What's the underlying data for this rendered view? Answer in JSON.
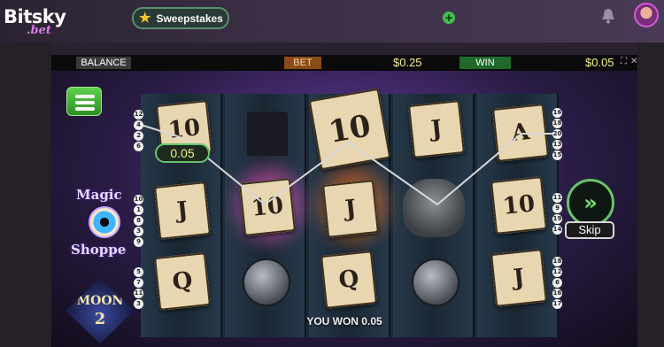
{
  "header": {
    "logo_text": "Bitsky",
    "logo_sub": ".bet",
    "sweepstakes_label": "Sweepstakes",
    "add_label": "+"
  },
  "hud": {
    "balance_label": "BALANCE",
    "bet_label": "BET",
    "bet_value": "$0.25",
    "win_label": "WIN",
    "win_value": "$0.05"
  },
  "game": {
    "logo_magic_line1": "Magic",
    "logo_magic_line2": "Shoppe",
    "logo_moon_line1": "MOON",
    "logo_moon_line2": "2",
    "line_win_badge": "0.05",
    "skip_label": "Skip",
    "you_won_text": "YOU WON 0.05",
    "left_lines_top": [
      "12",
      "4",
      "2",
      "6"
    ],
    "left_lines_mid": [
      "10",
      "1",
      "8",
      "3",
      "9"
    ],
    "left_lines_bot": [
      "5",
      "7",
      "11",
      "3"
    ],
    "right_lines_top": [
      "16",
      "18",
      "20",
      "13",
      "15"
    ],
    "right_lines_mid": [
      "11",
      "9",
      "19",
      "14"
    ],
    "right_lines_bot": [
      "18",
      "12",
      "6",
      "16",
      "17"
    ]
  },
  "reels": [
    {
      "symbols": [
        "10",
        "J",
        "Q"
      ]
    },
    {
      "symbols": [
        "hat",
        "10",
        "coin"
      ]
    },
    {
      "symbols": [
        "10",
        "J",
        "Q"
      ]
    },
    {
      "symbols": [
        "J",
        "skull",
        "coin"
      ]
    },
    {
      "symbols": [
        "A",
        "10",
        "J"
      ]
    }
  ],
  "colors": {
    "accent_green": "#67c46a",
    "value_yellow": "#f6f08a",
    "brand_purple": "#d97be6"
  }
}
